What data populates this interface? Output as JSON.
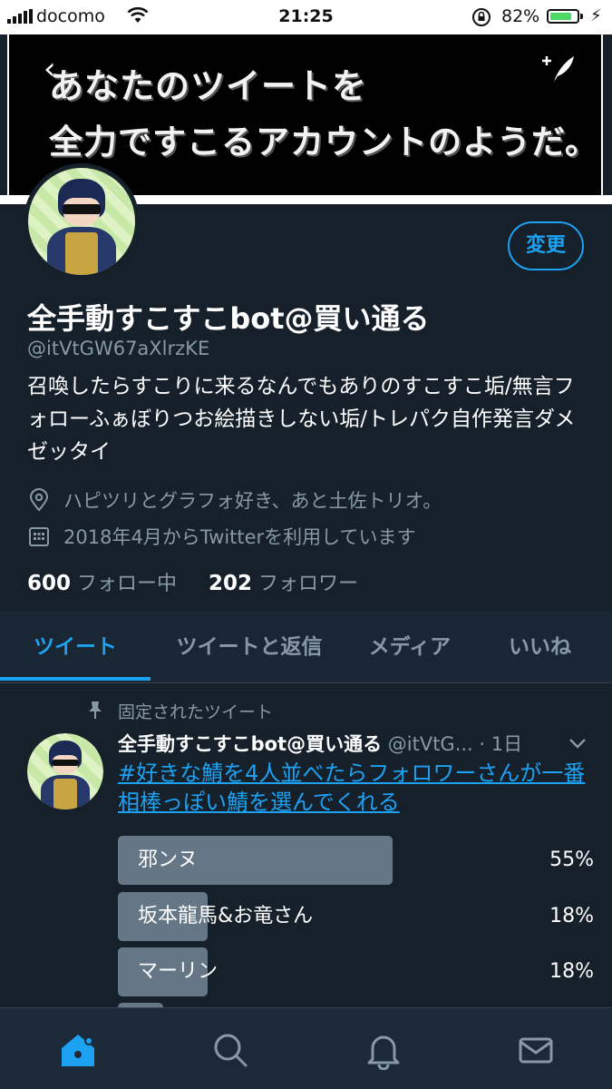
{
  "status_bar": {
    "carrier": "docomo",
    "time": "21:25",
    "battery": "82%",
    "battery_level": 0.82
  },
  "banner": {
    "line1": "あなたのツイートを",
    "line2": "全力ですこるアカウントのようだ。"
  },
  "profile": {
    "edit_label": "変更",
    "name": "全手動すこすこbot@買い通る",
    "handle": "@itVtGW67aXlrzKE",
    "bio": "召喚したらすこりに来るなんでもありのすこすこ垢/無言フォローふぁぼりつお絵描きしない垢/トレパク自作発言ダメゼッタイ",
    "location": "ハピツリとグラフォ好き、あと土佐トリオ。",
    "joined": "2018年4月からTwitterを利用しています",
    "following_count": "600",
    "following_label": "フォロー中",
    "followers_count": "202",
    "followers_label": "フォロワー"
  },
  "tabs": [
    {
      "label": "ツイート",
      "active": true
    },
    {
      "label": "ツイートと返信",
      "active": false
    },
    {
      "label": "メディア",
      "active": false
    },
    {
      "label": "いいね",
      "active": false
    }
  ],
  "pinned_tweet": {
    "pinned_label": "固定されたツイート",
    "name": "全手動すこすこbot@買い通る",
    "handle_time": "@itVtG... · 1日",
    "text": "#好きな鯖を4人並べたらフォロワーさんが一番相棒っぽい鯖を選んでくれる",
    "poll": [
      {
        "label": "邪ンヌ",
        "pct": "55%",
        "value": 55
      },
      {
        "label": "坂本龍馬&お竜さん",
        "pct": "18%",
        "value": 18
      },
      {
        "label": "マーリン",
        "pct": "18%",
        "value": 18
      },
      {
        "label": "",
        "pct": "",
        "value": 9
      }
    ]
  },
  "bottom_nav": [
    "home-icon",
    "search-icon",
    "bell-icon",
    "mail-icon"
  ],
  "colors": {
    "background": "#15202b",
    "accent": "#1da1f2",
    "secondary_text": "#8899a6"
  }
}
